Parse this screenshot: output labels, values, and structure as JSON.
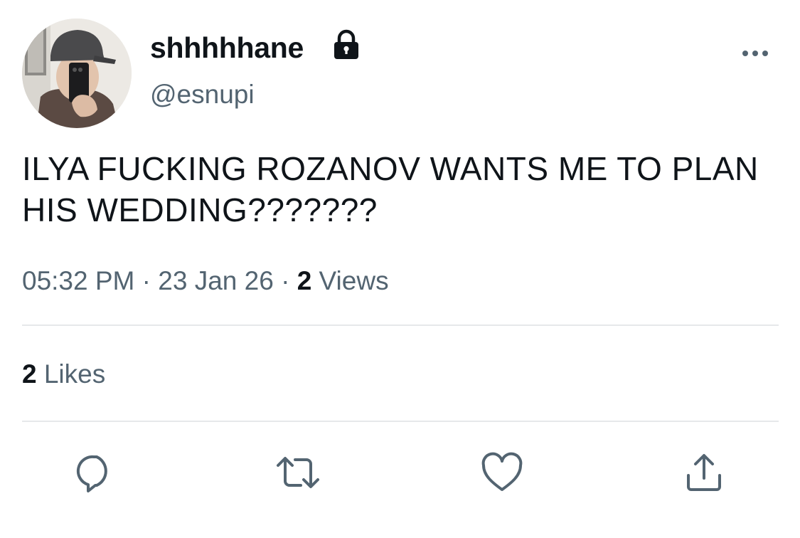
{
  "user": {
    "display_name": "shhhhhane",
    "handle": "@esnupi",
    "avatar_icon": "profile-photo",
    "protected_icon": "lock-icon"
  },
  "tweet": {
    "text": "ILYA FUCKING ROZANOV WANTS ME TO PLAN HIS WEDDING???????",
    "time": "05:32 PM",
    "separator": "·",
    "date": "23 Jan 26",
    "views_count": "2",
    "views_label": "Views",
    "likes_count": "2",
    "likes_label": "Likes"
  },
  "actions": {
    "reply_icon": "reply-icon",
    "retweet_icon": "retweet-icon",
    "like_icon": "heart-icon",
    "share_icon": "share-icon",
    "more_icon": "more-icon"
  },
  "colors": {
    "text_primary": "#0f1419",
    "text_secondary": "#536471",
    "divider": "#e6e8ea",
    "icon": "#536471"
  }
}
